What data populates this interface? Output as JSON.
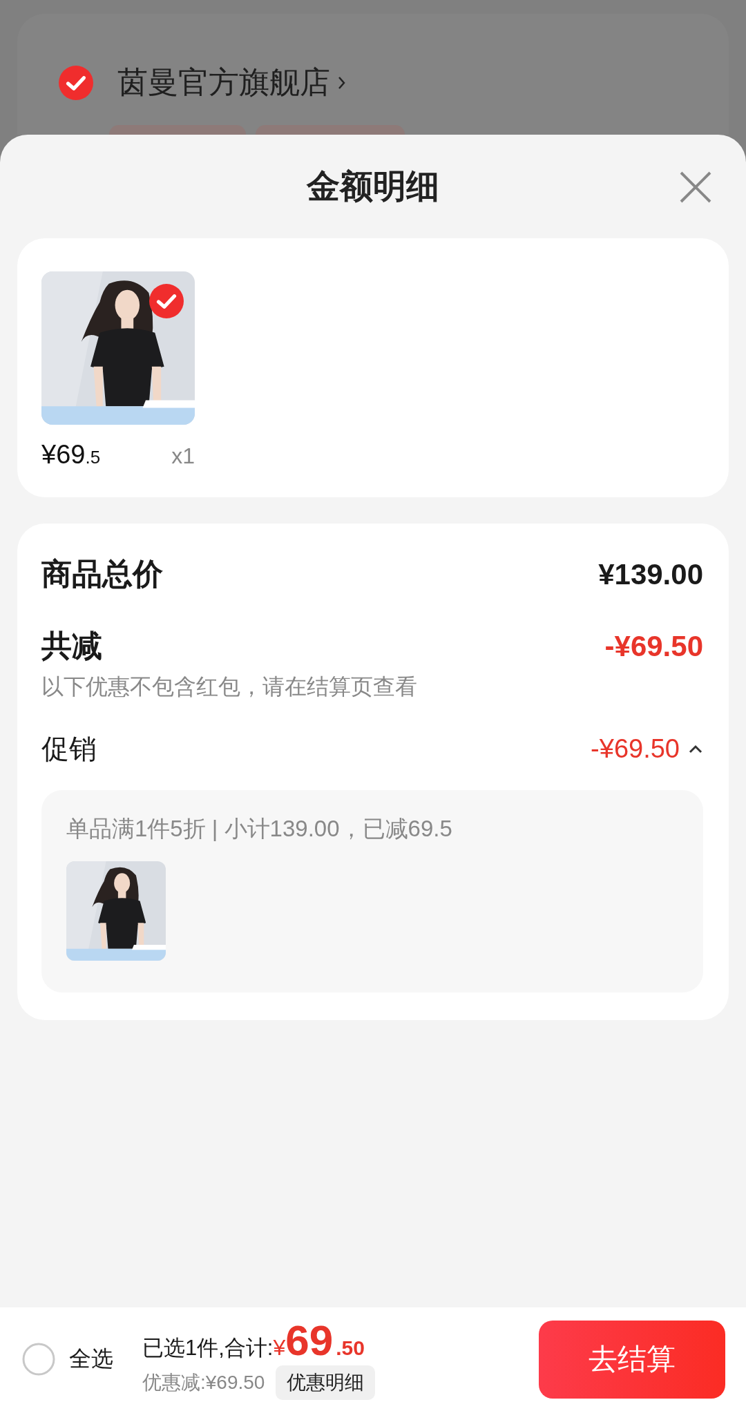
{
  "backdrop": {
    "store": {
      "name": "茵曼官方旗舰店",
      "checked": true
    }
  },
  "sheet": {
    "title": "金额明细"
  },
  "items": [
    {
      "kind": "picture",
      "selected": true,
      "price_main": "¥69",
      "price_decimal": ".5",
      "quantity": "x1"
    }
  ],
  "summary": {
    "total_label": "商品总价",
    "total": "¥139.00",
    "discount_label": "共减",
    "discount": "-¥69.50",
    "discount_note": "以下优惠不包含红包，请在结算页查看",
    "promo": {
      "label": "促销",
      "amount": "-¥69.50",
      "expanded": true,
      "detail": "单品满1件5折 | 小计139.00，已减69.5"
    }
  },
  "bottom_bar": {
    "select_all": {
      "label": "全选",
      "checked": false
    },
    "selected_text": "已选1件,合计:",
    "currency": "¥",
    "total_main": "69",
    "total_decimal": ".50",
    "saving": "优惠减:¥69.50",
    "details_button": "优惠明细",
    "checkout_button": "去结算"
  }
}
